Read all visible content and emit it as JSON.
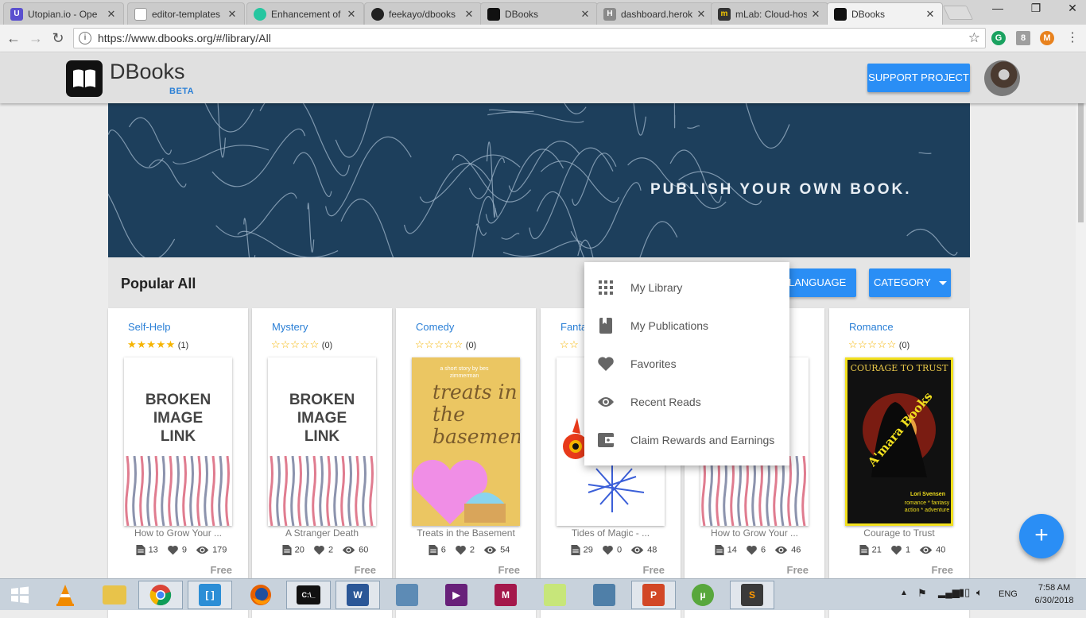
{
  "browser": {
    "tabs": [
      {
        "title": "Utopian.io - Ope",
        "icon_color": "#5a4fcf"
      },
      {
        "title": "editor-templates",
        "icon_color": "#9e9e9e"
      },
      {
        "title": "Enhancement of",
        "icon_color": "#26c6a0"
      },
      {
        "title": "feekayo/dbooks",
        "icon_color": "#222222"
      },
      {
        "title": "DBooks",
        "icon_color": "#111111"
      },
      {
        "title": "dashboard.herok",
        "icon_color": "#8a8a8a"
      },
      {
        "title": "mLab: Cloud-hos",
        "icon_color": "#333333"
      },
      {
        "title": "DBooks",
        "icon_color": "#111111"
      }
    ],
    "url": "https://www.dbooks.org/#/library/All",
    "extensions": [
      "G",
      "8",
      "M"
    ]
  },
  "header": {
    "brand": "DBooks",
    "badge": "BETA",
    "support_label": "SUPPORT PROJECT"
  },
  "banner": {
    "text": "PUBLISH YOUR OWN BOOK."
  },
  "section": {
    "title": "Popular All",
    "language_label": "LANGUAGE",
    "category_label": "CATEGORY"
  },
  "menu": {
    "items": [
      {
        "label": "My Library",
        "icon": "grid-icon"
      },
      {
        "label": "My Publications",
        "icon": "book-icon"
      },
      {
        "label": "Favorites",
        "icon": "heart-icon"
      },
      {
        "label": "Recent Reads",
        "icon": "eye-icon"
      },
      {
        "label": "Claim Rewards and Earnings",
        "icon": "wallet-icon"
      }
    ]
  },
  "books": [
    {
      "category": "Self-Help",
      "stars": "★★★★★",
      "rating_count": "(1)",
      "cover": "broken",
      "cover_text": "BROKEN IMAGE LINK",
      "title": "How to Grow Your ...",
      "pages": "13",
      "likes": "9",
      "views": "179",
      "price": "Free"
    },
    {
      "category": "Mystery",
      "stars": "☆☆☆☆☆",
      "rating_count": "(0)",
      "cover": "broken",
      "cover_text": "BROKEN IMAGE LINK",
      "title": "A Stranger Death",
      "pages": "20",
      "likes": "2",
      "views": "60",
      "price": "Free"
    },
    {
      "category": "Comedy",
      "stars": "☆☆☆☆☆",
      "rating_count": "(0)",
      "cover": "treats",
      "cover_small": "a short story by bes zimmerman",
      "cover_text": "treats in the basement",
      "title": "Treats in the Basement",
      "pages": "6",
      "likes": "2",
      "views": "54",
      "price": "Free"
    },
    {
      "category": "Fanta",
      "stars": "☆☆",
      "rating_count": "",
      "cover": "magic",
      "title": "Tides of Magic - ...",
      "pages": "29",
      "likes": "0",
      "views": "48",
      "price": "Free"
    },
    {
      "category": "",
      "stars": "",
      "rating_count": "",
      "cover": "broken",
      "cover_text": "BROKEN IMAGE LINK",
      "title": "How to Grow Your ...",
      "pages": "14",
      "likes": "6",
      "views": "46",
      "price": "Free"
    },
    {
      "category": "Romance",
      "stars": "☆☆☆☆☆",
      "rating_count": "(0)",
      "cover": "romance",
      "cover_top": "COURAGE TO TRUST",
      "cover_text": "A'mara Books",
      "cover_author": "Lori Svensen",
      "cover_tag": "romance * fantasy action * adventure",
      "title": "Courage to Trust",
      "pages": "21",
      "likes": "1",
      "views": "40",
      "price": "Free"
    }
  ],
  "fab": {
    "label": "+"
  },
  "taskbar": {
    "time": "7:58 AM",
    "date": "6/30/2018",
    "lang": "ENG"
  },
  "colors": {
    "primary": "#2a8ef5",
    "banner": "#1d3f5c",
    "star": "#f5b400",
    "link": "#2a7fd6"
  }
}
